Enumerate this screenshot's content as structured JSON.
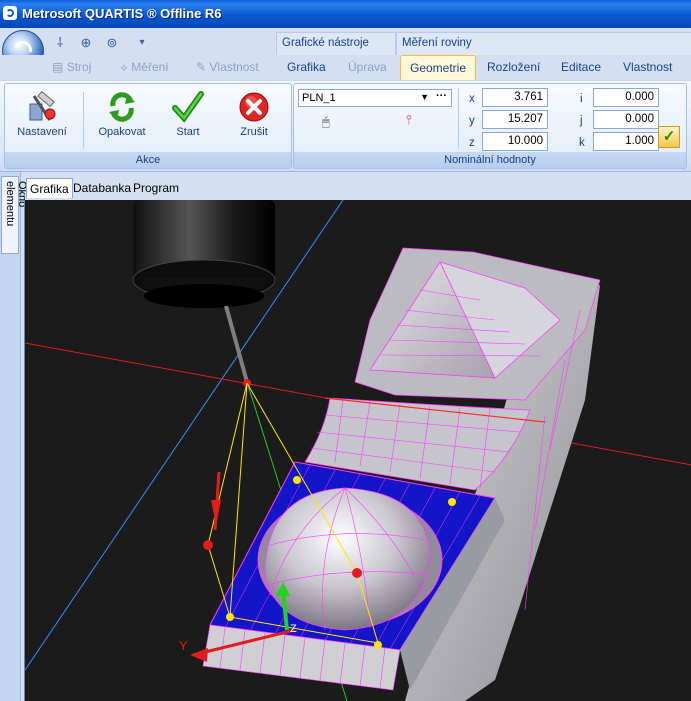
{
  "window": {
    "title": "Metrosoft QUARTIS ® Offline R6"
  },
  "context_groups": [
    {
      "label": "Grafické nástroje"
    },
    {
      "label": "Měření roviny"
    }
  ],
  "ribbon_tabs": {
    "stroj": "Stroj",
    "mereni": "Měření",
    "vlastnost_disabled": "Vlastnost",
    "grafika": "Grafika",
    "uprava": "Úprava",
    "geometrie": "Geometrie",
    "rozlozeni": "Rozložení",
    "editace": "Editace",
    "vlastnost": "Vlastnost"
  },
  "akce": {
    "title": "Akce",
    "nastaveni": "Nastavení",
    "opakovat": "Opakovat",
    "start": "Start",
    "zrusit": "Zrušit"
  },
  "nominal": {
    "title": "Nominální hodnoty",
    "feature": "PLN_1",
    "x_label": "x",
    "x": "3.761",
    "y_label": "y",
    "y": "15.207",
    "z_label": "z",
    "z": "10.000",
    "i_label": "i",
    "i": "0.000",
    "j_label": "j",
    "j": "0.000",
    "k_label": "k",
    "k": "1.000"
  },
  "side_panel": {
    "tab": "Okno elementu"
  },
  "view_tabs": {
    "grafika": "Grafika",
    "databanka": "Databanka",
    "program": "Program"
  },
  "viewport": {
    "axis_labels": {
      "y": "Y",
      "z": "Z"
    },
    "colors": {
      "background": "#1b1b1b",
      "mesh": "#ff3cff",
      "plane": "#1a1ad6",
      "part": "#c8c8cc"
    }
  }
}
